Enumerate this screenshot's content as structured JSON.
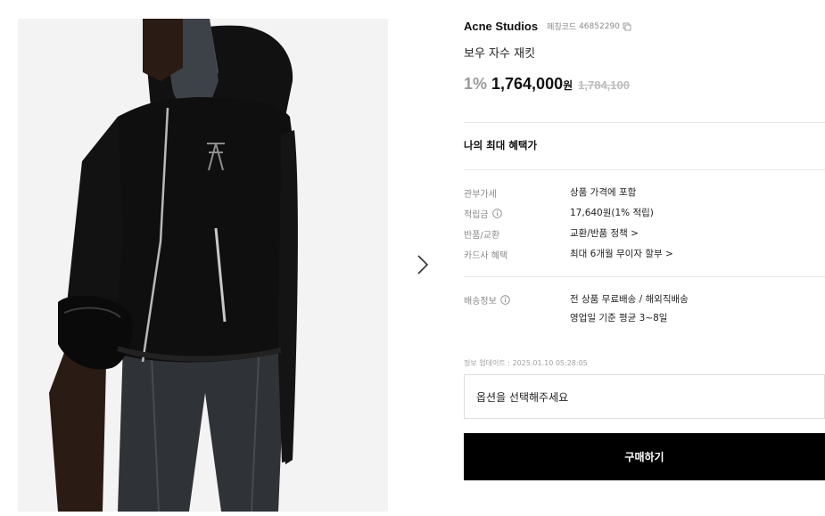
{
  "gallery": {
    "image_alt": "Black hooded wool jacket with embroidered bow on model",
    "next_icon": "chevron-right-icon"
  },
  "product": {
    "brand": "Acne Studios",
    "matching_code_label": "페칭코드",
    "matching_code": "46852290",
    "copy_icon": "copy-icon",
    "name": "보우 자수 재킷",
    "discount": "1%",
    "price": "1,764,000",
    "currency": "원",
    "original_price": "1,784,100"
  },
  "benefits": {
    "title": "나의 최대 혜택가",
    "rows": [
      {
        "label": "관부가세",
        "value": "상품 가격에 포함"
      },
      {
        "label": "적립금",
        "value": "17,640원(1% 적립)",
        "info_icon": "info-icon"
      },
      {
        "label": "반품/교환",
        "value": "교환/반품 정책 >"
      },
      {
        "label": "카드사 혜택",
        "value": "최대 6개월 무이자 할부 >"
      }
    ]
  },
  "shipping": {
    "label": "배송정보",
    "info_icon": "info-icon",
    "line1": "전 상품 무료배송 / 해외직배송",
    "line2": "영업일 기준 평균 3~8일"
  },
  "updated": "정보 업데이트 : 2025.01.10 05:28:05",
  "option": {
    "placeholder": "옵션을 선택해주세요"
  },
  "buy_button": {
    "label": "구매하기"
  },
  "colors": {
    "accent": "#000000",
    "muted": "#8a8a8a",
    "strike": "#bdbdbd"
  }
}
